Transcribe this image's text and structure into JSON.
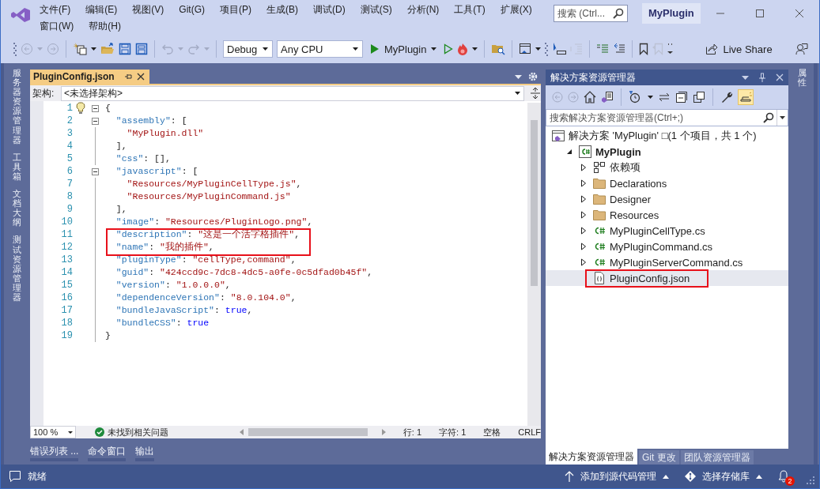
{
  "window": {
    "title": "MyPlugin",
    "search_placeholder": "搜索 (Ctrl..."
  },
  "menu": [
    "文件(F)",
    "编辑(E)",
    "视图(V)",
    "Git(G)",
    "项目(P)",
    "生成(B)",
    "调试(D)",
    "测试(S)",
    "分析(N)",
    "工具(T)",
    "扩展(X)",
    "窗口(W)",
    "帮助(H)"
  ],
  "toolbar": {
    "configuration": "Debug",
    "platform": "Any CPU",
    "start_target": "MyPlugin",
    "live_share": "Live Share"
  },
  "left_tabs": [
    "服务器资源管理器",
    "工具箱",
    "文档大纲",
    "测试资源管理器"
  ],
  "editor": {
    "tab": {
      "label": "PluginConfig.json",
      "selected": true
    },
    "nav_label": "架构:",
    "nav_value": "<未选择架构>",
    "lines": [
      {
        "number": "1",
        "tokens": [
          {
            "kind": "punct",
            "text": "{"
          }
        ],
        "collapsible": true,
        "lightbulb": true,
        "boxed": false
      },
      {
        "number": "2",
        "tokens": [
          {
            "kind": "key",
            "text": "  \"assembly\""
          },
          {
            "kind": "punct",
            "text": ": ["
          }
        ],
        "collapsible": true,
        "lightbulb": false,
        "boxed": false
      },
      {
        "number": "3",
        "tokens": [
          {
            "kind": "string",
            "text": "    \"MyPlugin.dll\""
          }
        ],
        "collapsible": false,
        "lightbulb": false,
        "boxed": false
      },
      {
        "number": "4",
        "tokens": [
          {
            "kind": "punct",
            "text": "  ],"
          }
        ],
        "collapsible": false,
        "lightbulb": false,
        "boxed": false
      },
      {
        "number": "5",
        "tokens": [
          {
            "kind": "key",
            "text": "  \"css\""
          },
          {
            "kind": "punct",
            "text": ": [],"
          }
        ],
        "collapsible": false,
        "lightbulb": false,
        "boxed": false
      },
      {
        "number": "6",
        "tokens": [
          {
            "kind": "key",
            "text": "  \"javascript\""
          },
          {
            "kind": "punct",
            "text": ": ["
          }
        ],
        "collapsible": true,
        "lightbulb": false,
        "boxed": false
      },
      {
        "number": "7",
        "tokens": [
          {
            "kind": "string",
            "text": "    \"Resources/MyPluginCellType.js\""
          },
          {
            "kind": "punct",
            "text": ","
          }
        ],
        "collapsible": false,
        "lightbulb": false,
        "boxed": false
      },
      {
        "number": "8",
        "tokens": [
          {
            "kind": "string",
            "text": "    \"Resources/MyPluginCommand.js\""
          }
        ],
        "collapsible": false,
        "lightbulb": false,
        "boxed": false
      },
      {
        "number": "9",
        "tokens": [
          {
            "kind": "punct",
            "text": "  ],"
          }
        ],
        "collapsible": false,
        "lightbulb": false,
        "boxed": false
      },
      {
        "number": "10",
        "tokens": [
          {
            "kind": "key",
            "text": "  \"image\""
          },
          {
            "kind": "punct",
            "text": ": "
          },
          {
            "kind": "string",
            "text": "\"Resources/PluginLogo.png\""
          },
          {
            "kind": "punct",
            "text": ","
          }
        ],
        "collapsible": false,
        "lightbulb": false,
        "boxed": false
      },
      {
        "number": "11",
        "tokens": [
          {
            "kind": "key",
            "text": "  \"description\""
          },
          {
            "kind": "punct",
            "text": ": "
          },
          {
            "kind": "string",
            "text": "\"这是一个活字格插件\""
          },
          {
            "kind": "punct",
            "text": ","
          }
        ],
        "collapsible": false,
        "lightbulb": false,
        "boxed": true
      },
      {
        "number": "12",
        "tokens": [
          {
            "kind": "key",
            "text": "  \"name\""
          },
          {
            "kind": "punct",
            "text": ": "
          },
          {
            "kind": "string",
            "text": "\"我的插件\""
          },
          {
            "kind": "punct",
            "text": ","
          }
        ],
        "collapsible": false,
        "lightbulb": false,
        "boxed": true
      },
      {
        "number": "13",
        "tokens": [
          {
            "kind": "key",
            "text": "  \"pluginType\""
          },
          {
            "kind": "punct",
            "text": ": "
          },
          {
            "kind": "string",
            "text": "\"cellType,command\""
          },
          {
            "kind": "punct",
            "text": ","
          }
        ],
        "collapsible": false,
        "lightbulb": false,
        "boxed": false
      },
      {
        "number": "14",
        "tokens": [
          {
            "kind": "key",
            "text": "  \"guid\""
          },
          {
            "kind": "punct",
            "text": ": "
          },
          {
            "kind": "string",
            "text": "\"424ccd9c-7dc8-4dc5-a0fe-0c5dfad0b45f\""
          },
          {
            "kind": "punct",
            "text": ","
          }
        ],
        "collapsible": false,
        "lightbulb": false,
        "boxed": false
      },
      {
        "number": "15",
        "tokens": [
          {
            "kind": "key",
            "text": "  \"version\""
          },
          {
            "kind": "punct",
            "text": ": "
          },
          {
            "kind": "string",
            "text": "\"1.0.0.0\""
          },
          {
            "kind": "punct",
            "text": ","
          }
        ],
        "collapsible": false,
        "lightbulb": false,
        "boxed": false
      },
      {
        "number": "16",
        "tokens": [
          {
            "kind": "key",
            "text": "  \"dependenceVersion\""
          },
          {
            "kind": "punct",
            "text": ": "
          },
          {
            "kind": "string",
            "text": "\"8.0.104.0\""
          },
          {
            "kind": "punct",
            "text": ","
          }
        ],
        "collapsible": false,
        "lightbulb": false,
        "boxed": false
      },
      {
        "number": "17",
        "tokens": [
          {
            "kind": "key",
            "text": "  \"bundleJavaScript\""
          },
          {
            "kind": "punct",
            "text": ": "
          },
          {
            "kind": "keyword",
            "text": "true"
          },
          {
            "kind": "punct",
            "text": ","
          }
        ],
        "collapsible": false,
        "lightbulb": false,
        "boxed": false
      },
      {
        "number": "18",
        "tokens": [
          {
            "kind": "key",
            "text": "  \"bundleCSS\""
          },
          {
            "kind": "punct",
            "text": ": "
          },
          {
            "kind": "keyword",
            "text": "true"
          }
        ],
        "collapsible": false,
        "lightbulb": false,
        "boxed": false
      },
      {
        "number": "19",
        "tokens": [
          {
            "kind": "punct",
            "text": "}"
          }
        ],
        "collapsible": false,
        "lightbulb": false,
        "boxed": false
      }
    ],
    "status": {
      "zoom": "100 %",
      "issues": "未找到相关问题",
      "line": "行: 1",
      "column": "字符: 1",
      "indent": "空格",
      "line_ending": "CRLF"
    }
  },
  "bottom_tabs": [
    "错误列表 ...",
    "命令窗口",
    "输出"
  ],
  "solution_explorer": {
    "title": "解决方案资源管理器",
    "search_placeholder": "搜索解决方案资源管理器(Ctrl+;)",
    "tree": [
      {
        "kind": "solution",
        "label": "解决方案 'MyPlugin' □(1 个项目，共 1 个)",
        "selected": false,
        "boxed": false,
        "children": [
          {
            "kind": "project",
            "label": "MyPlugin",
            "expanded": true,
            "selected": false,
            "boxed": false,
            "children": [
              {
                "kind": "dependencies",
                "label": "依赖项",
                "expanded": false,
                "selected": false,
                "boxed": false
              },
              {
                "kind": "folder",
                "label": "Declarations",
                "expanded": false,
                "selected": false,
                "boxed": false
              },
              {
                "kind": "folder",
                "label": "Designer",
                "expanded": false,
                "selected": false,
                "boxed": false
              },
              {
                "kind": "folder",
                "label": "Resources",
                "expanded": false,
                "selected": false,
                "boxed": false
              },
              {
                "kind": "csharp",
                "label": "MyPluginCellType.cs",
                "expanded": false,
                "selected": false,
                "boxed": false
              },
              {
                "kind": "csharp",
                "label": "MyPluginCommand.cs",
                "expanded": false,
                "selected": false,
                "boxed": false
              },
              {
                "kind": "csharp",
                "label": "MyPluginServerCommand.cs",
                "expanded": false,
                "selected": false,
                "boxed": false
              },
              {
                "kind": "json",
                "label": "PluginConfig.json",
                "selected": true,
                "boxed": true
              }
            ]
          }
        ]
      }
    ],
    "tabs": [
      {
        "label": "解决方案资源管理器",
        "selected": true
      },
      {
        "label": "Git 更改",
        "selected": false
      },
      {
        "label": "团队资源管理器",
        "selected": false
      }
    ]
  },
  "right_tabs": [
    "属性"
  ],
  "status_bar": {
    "message": "就绪",
    "source_control": "添加到源代码管理",
    "repository": "选择存储库",
    "notification_count": "2"
  }
}
